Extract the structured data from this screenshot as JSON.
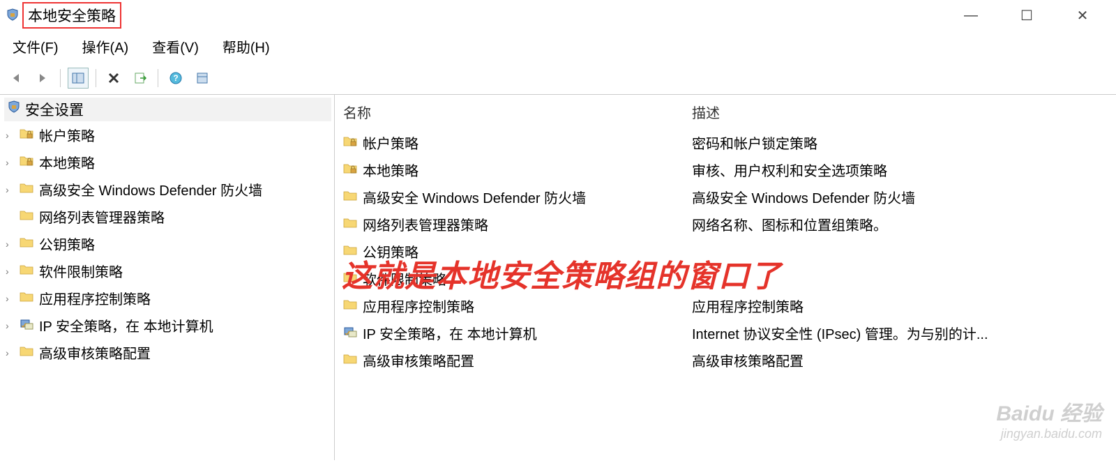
{
  "window": {
    "title": "本地安全策略",
    "controls": {
      "minimize": "—",
      "maximize": "☐",
      "close": "✕"
    }
  },
  "menubar": {
    "file": "文件(F)",
    "action": "操作(A)",
    "view": "查看(V)",
    "help": "帮助(H)"
  },
  "toolbar_icons": {
    "back": "back-arrow",
    "forward": "forward-arrow",
    "up": "pane-toggle",
    "delete": "delete-x",
    "export": "export-list",
    "help": "help-question",
    "props": "show-properties"
  },
  "tree": {
    "root": "安全设置",
    "items": [
      {
        "label": "帐户策略",
        "expandable": true,
        "icon": "folder-lock"
      },
      {
        "label": "本地策略",
        "expandable": true,
        "icon": "folder-lock"
      },
      {
        "label": "高级安全 Windows Defender 防火墙",
        "expandable": true,
        "icon": "folder"
      },
      {
        "label": "网络列表管理器策略",
        "expandable": false,
        "icon": "folder"
      },
      {
        "label": "公钥策略",
        "expandable": true,
        "icon": "folder"
      },
      {
        "label": "软件限制策略",
        "expandable": true,
        "icon": "folder"
      },
      {
        "label": "应用程序控制策略",
        "expandable": true,
        "icon": "folder"
      },
      {
        "label": "IP 安全策略，在 本地计算机",
        "expandable": true,
        "icon": "ipsec"
      },
      {
        "label": "高级审核策略配置",
        "expandable": true,
        "icon": "folder"
      }
    ]
  },
  "list": {
    "columns": {
      "name": "名称",
      "desc": "描述"
    },
    "rows": [
      {
        "name": "帐户策略",
        "desc": "密码和帐户锁定策略",
        "icon": "folder-lock"
      },
      {
        "name": "本地策略",
        "desc": "审核、用户权利和安全选项策略",
        "icon": "folder-lock"
      },
      {
        "name": "高级安全 Windows Defender 防火墙",
        "desc": "高级安全 Windows Defender 防火墙",
        "icon": "folder"
      },
      {
        "name": "网络列表管理器策略",
        "desc": "网络名称、图标和位置组策略。",
        "icon": "folder"
      },
      {
        "name": "公钥策略",
        "desc": "",
        "icon": "folder"
      },
      {
        "name": "软件限制策略",
        "desc": "",
        "icon": "folder"
      },
      {
        "name": "应用程序控制策略",
        "desc": "应用程序控制策略",
        "icon": "folder"
      },
      {
        "name": "IP 安全策略，在 本地计算机",
        "desc": "Internet 协议安全性 (IPsec) 管理。为与别的计...",
        "icon": "ipsec"
      },
      {
        "name": "高级审核策略配置",
        "desc": "高级审核策略配置",
        "icon": "folder"
      }
    ]
  },
  "annotation": "这就是本地安全策略组的窗口了",
  "watermark": {
    "main": "Baidu 经验",
    "sub": "jingyan.baidu.com"
  }
}
